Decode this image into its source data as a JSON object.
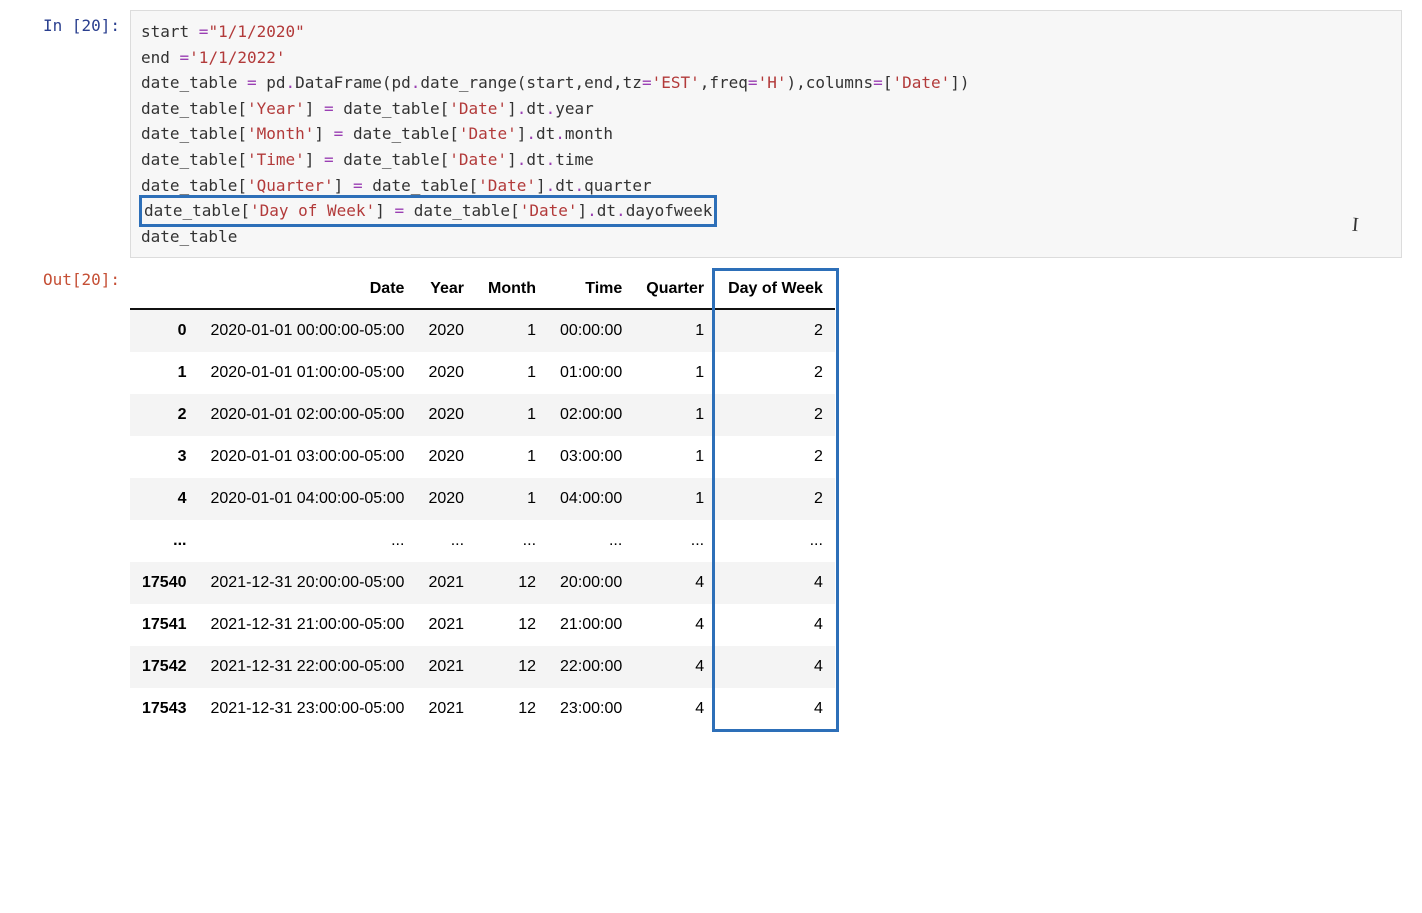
{
  "prompt_in": "In [20]:",
  "prompt_out": "Out[20]:",
  "code": {
    "l1a": "start ",
    "l1eq": "=",
    "l1s": "\"1/1/2020\"",
    "l2a": "end ",
    "l2eq": "=",
    "l2s": "'1/1/2022'",
    "l3a": "date_table ",
    "l3eq": "= ",
    "l3b": "pd",
    "l3dot": ".",
    "l3c": "DataFrame(pd",
    "l3d": "date_range(start,end,tz",
    "l3op2": "=",
    "l3s1": "'EST'",
    "l3e": ",freq",
    "l3op3": "=",
    "l3s2": "'H'",
    "l3f": "),columns",
    "l3op4": "=",
    "l3g": "[",
    "l3s3": "'Date'",
    "l3h": "])",
    "l4a": "date_table[",
    "l4s1": "'Year'",
    "l4b": "] ",
    "l4eq": "= ",
    "l4c": "date_table[",
    "l4s2": "'Date'",
    "l4d": "]",
    "l4dot": ".",
    "l4e": "dt",
    "l4f": "year",
    "l5a": "date_table[",
    "l5s1": "'Month'",
    "l5b": "] ",
    "l5eq": "= ",
    "l5c": "date_table[",
    "l5s2": "'Date'",
    "l5d": "]",
    "l5dot": ".",
    "l5e": "dt",
    "l5f": "month",
    "l6a": "date_table[",
    "l6s1": "'Time'",
    "l6b": "] ",
    "l6eq": "= ",
    "l6c": "date_table[",
    "l6s2": "'Date'",
    "l6d": "]",
    "l6dot": ".",
    "l6e": "dt",
    "l6f": "time",
    "l7a": "date_table[",
    "l7s1": "'Quarter'",
    "l7b": "] ",
    "l7eq": "= ",
    "l7c": "date_table[",
    "l7s2": "'Date'",
    "l7d": "]",
    "l7dot": ".",
    "l7e": "dt",
    "l7f": "quarter",
    "l8a": "date_table[",
    "l8s1": "'Day of Week'",
    "l8b": "] ",
    "l8eq": "= ",
    "l8c": "date_table[",
    "l8s2": "'Date'",
    "l8d": "]",
    "l8dot": ".",
    "l8e": "dt",
    "l8f": "dayofweek",
    "l9": "date_table"
  },
  "df": {
    "columns": [
      "Date",
      "Year",
      "Month",
      "Time",
      "Quarter",
      "Day of Week"
    ],
    "rows": [
      {
        "idx": "0",
        "c": [
          "2020-01-01 00:00:00-05:00",
          "2020",
          "1",
          "00:00:00",
          "1",
          "2"
        ]
      },
      {
        "idx": "1",
        "c": [
          "2020-01-01 01:00:00-05:00",
          "2020",
          "1",
          "01:00:00",
          "1",
          "2"
        ]
      },
      {
        "idx": "2",
        "c": [
          "2020-01-01 02:00:00-05:00",
          "2020",
          "1",
          "02:00:00",
          "1",
          "2"
        ]
      },
      {
        "idx": "3",
        "c": [
          "2020-01-01 03:00:00-05:00",
          "2020",
          "1",
          "03:00:00",
          "1",
          "2"
        ]
      },
      {
        "idx": "4",
        "c": [
          "2020-01-01 04:00:00-05:00",
          "2020",
          "1",
          "04:00:00",
          "1",
          "2"
        ]
      },
      {
        "idx": "...",
        "c": [
          "...",
          "...",
          "...",
          "...",
          "...",
          "..."
        ]
      },
      {
        "idx": "17540",
        "c": [
          "2021-12-31 20:00:00-05:00",
          "2021",
          "12",
          "20:00:00",
          "4",
          "4"
        ]
      },
      {
        "idx": "17541",
        "c": [
          "2021-12-31 21:00:00-05:00",
          "2021",
          "12",
          "21:00:00",
          "4",
          "4"
        ]
      },
      {
        "idx": "17542",
        "c": [
          "2021-12-31 22:00:00-05:00",
          "2021",
          "12",
          "22:00:00",
          "4",
          "4"
        ]
      },
      {
        "idx": "17543",
        "c": [
          "2021-12-31 23:00:00-05:00",
          "2021",
          "12",
          "23:00:00",
          "4",
          "4"
        ]
      }
    ]
  },
  "cursor_glyph": "I"
}
